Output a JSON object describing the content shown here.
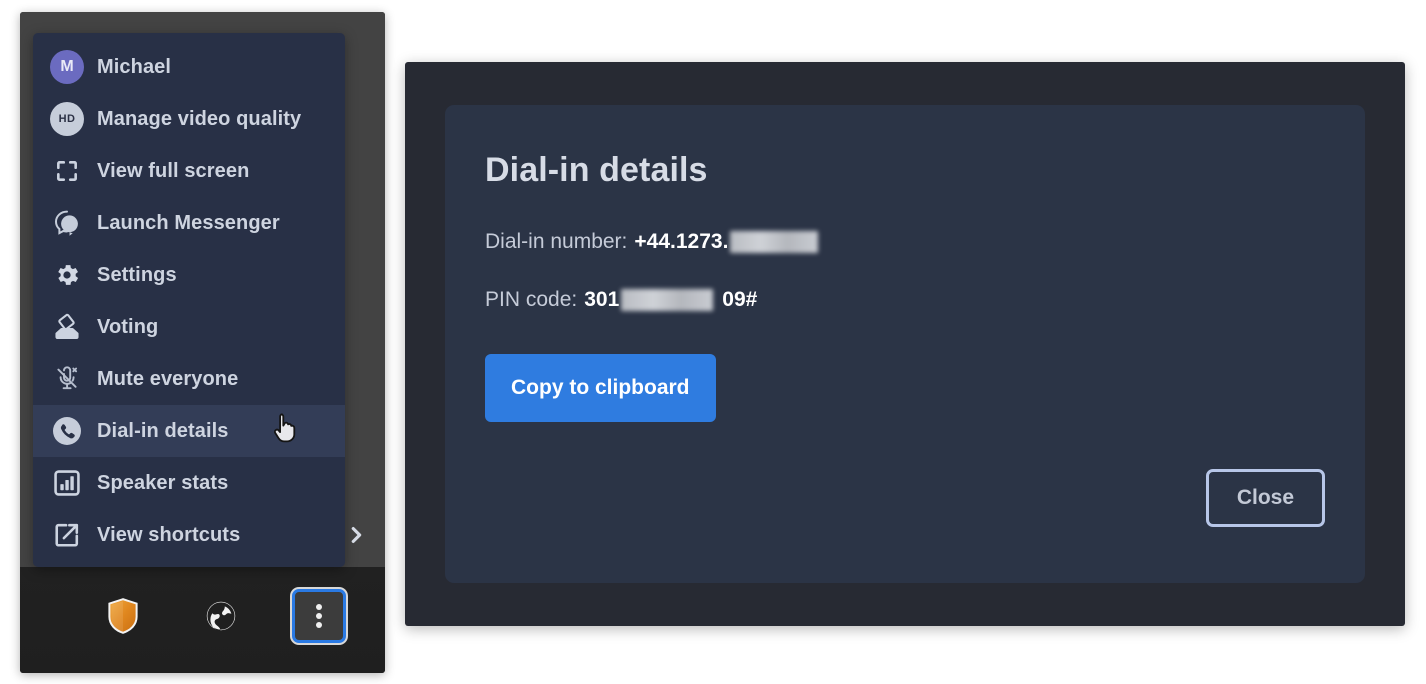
{
  "menu": {
    "items": [
      {
        "label": "Michael",
        "icon": "avatar-initial",
        "initial": "M",
        "highlighted": false
      },
      {
        "label": "Manage video quality",
        "icon": "hd-badge-icon",
        "badge": "HD",
        "highlighted": false
      },
      {
        "label": "View full screen",
        "icon": "fullscreen-icon",
        "highlighted": false
      },
      {
        "label": "Launch Messenger",
        "icon": "messenger-icon",
        "highlighted": false
      },
      {
        "label": "Settings",
        "icon": "gear-icon",
        "highlighted": false
      },
      {
        "label": "Voting",
        "icon": "ballot-box-icon",
        "highlighted": false
      },
      {
        "label": "Mute everyone",
        "icon": "mic-muted-icon",
        "highlighted": false
      },
      {
        "label": "Dial-in details",
        "icon": "phone-circle-icon",
        "highlighted": true
      },
      {
        "label": "Speaker stats",
        "icon": "bar-chart-icon",
        "highlighted": false
      },
      {
        "label": "View shortcuts",
        "icon": "external-link-icon",
        "highlighted": false
      }
    ],
    "submenu_arrow_icon": "chevron-right-icon"
  },
  "toolbar": {
    "buttons": [
      {
        "icon": "shield-icon",
        "active": false
      },
      {
        "icon": "globe-icon",
        "active": false
      },
      {
        "icon": "kebab-menu-icon",
        "active": true
      }
    ]
  },
  "cursor": {
    "icon": "pointing-hand-cursor"
  },
  "dialog": {
    "title": "Dial-in details",
    "dial_in": {
      "label": "Dial-in number:",
      "value_prefix": "+44.1273.",
      "value_redacted": true
    },
    "pin": {
      "label": "PIN code:",
      "value_prefix": "301",
      "value_suffix": "09#",
      "value_redacted": true
    },
    "copy_button_label": "Copy to clipboard",
    "close_button_label": "Close"
  },
  "colors": {
    "menu_bg": "#283046",
    "menu_highlight": "#333d57",
    "dialog_bg": "#2b3446",
    "panel_bg": "#272a33",
    "accent_blue": "#2f7ce0",
    "avatar_purple": "#6b6bc0",
    "focus_blue": "#2a7ae4",
    "shield_orange": "#e08b2a"
  }
}
